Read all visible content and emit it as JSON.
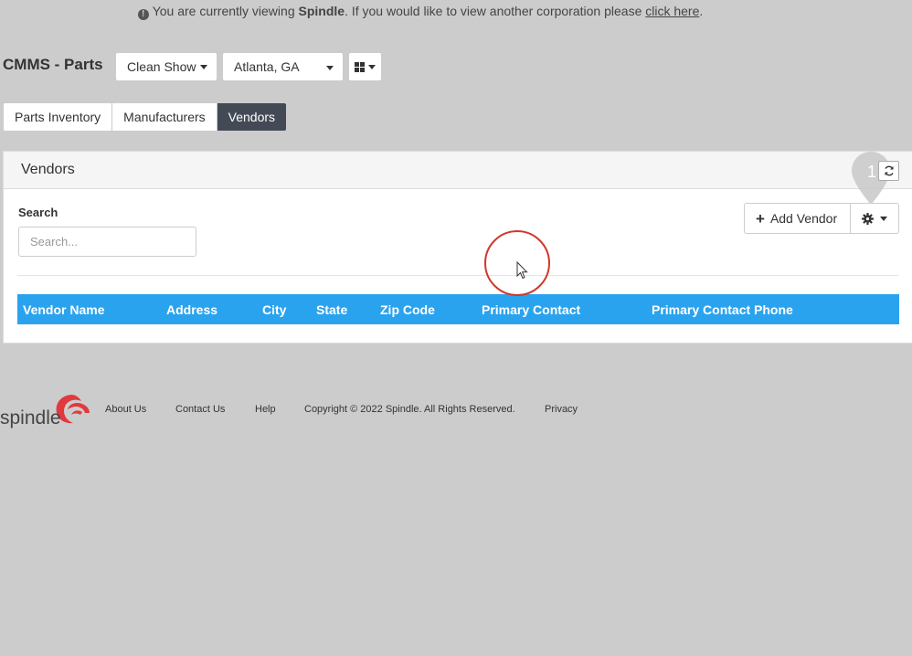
{
  "notice": {
    "prefix": "You are currently viewing ",
    "corporation": "Spindle",
    "middle": ". If you would like to view another corporation please ",
    "link": "click here",
    "suffix": "."
  },
  "page": {
    "title": "CMMS - Parts"
  },
  "toolbar": {
    "show_label": "Clean Show",
    "location_label": "Atlanta, GA",
    "grid_icon": "grid-icon"
  },
  "tabs": [
    {
      "label": "Parts Inventory",
      "active": false
    },
    {
      "label": "Manufacturers",
      "active": false
    },
    {
      "label": "Vendors",
      "active": true
    }
  ],
  "panel": {
    "title": "Vendors",
    "refresh_icon": "refresh-icon",
    "marker_number": "1",
    "search_label": "Search",
    "search_placeholder": "Search...",
    "search_value": "",
    "add_vendor_label": "Add Vendor",
    "settings_icon": "gear-icon"
  },
  "table": {
    "columns": [
      "Vendor Name",
      "Address",
      "City",
      "State",
      "Zip Code",
      "Primary Contact",
      "Primary Contact Phone"
    ],
    "header_color": "#2aa3ef"
  },
  "footer": {
    "logo_text": "spindle",
    "links": [
      "About Us",
      "Contact Us",
      "Help"
    ],
    "copyright": "Copyright © 2022 Spindle. All Rights Reserved.",
    "privacy": "Privacy"
  },
  "colors": {
    "accent": "#2aa3ef",
    "active_tab": "#444a55",
    "cursor_ring": "#d0382b",
    "logo_red": "#e03a3e"
  }
}
